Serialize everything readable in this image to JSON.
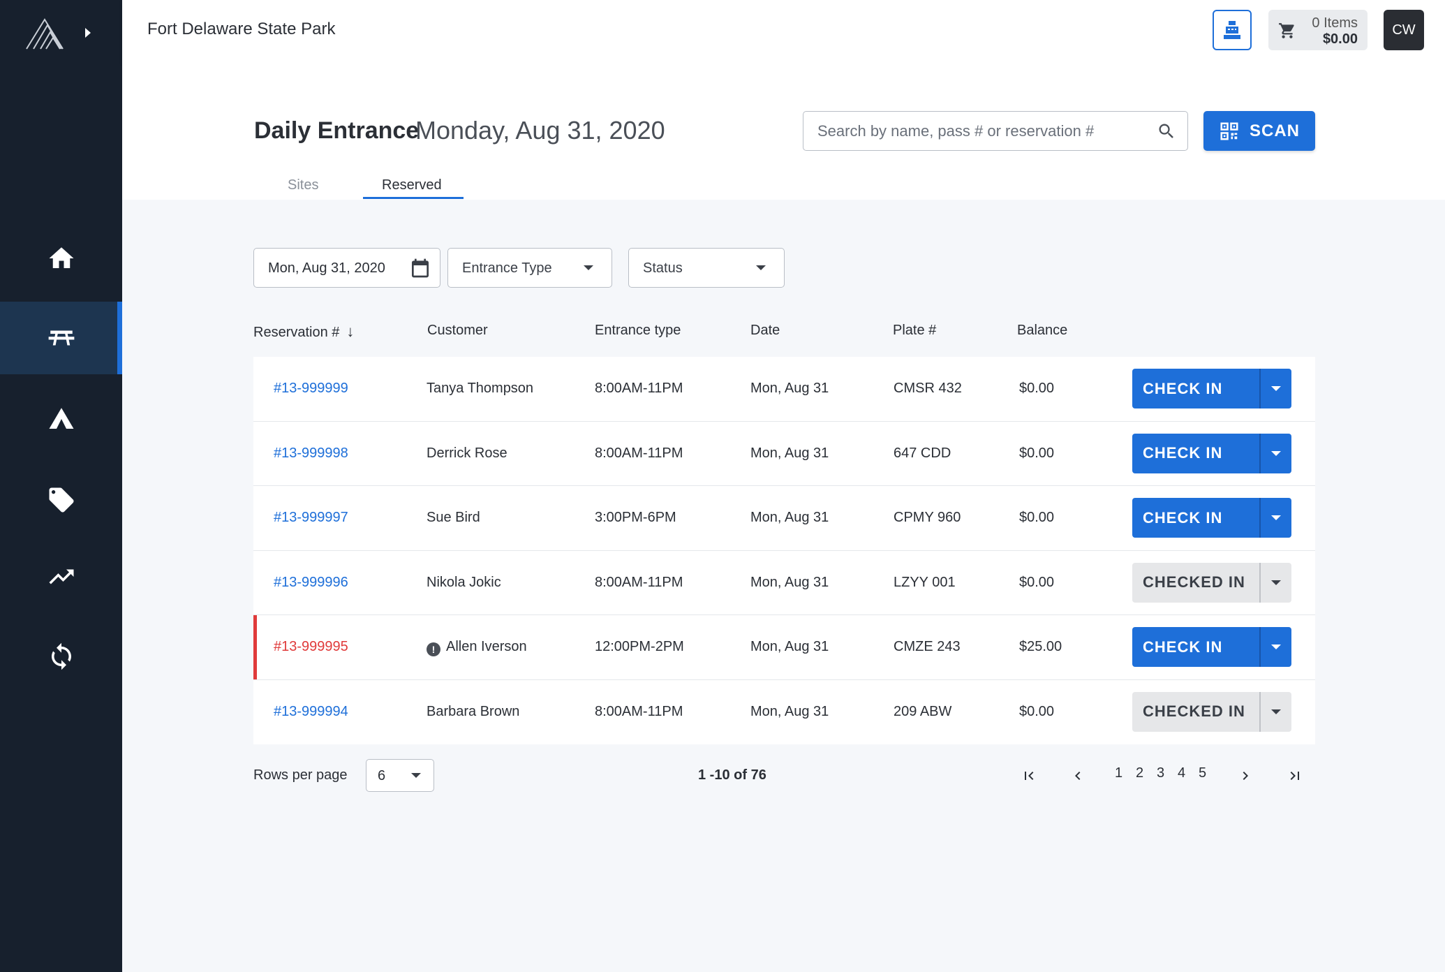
{
  "header": {
    "park_name": "Fort Delaware State Park",
    "cart_items": "0 Items",
    "cart_total": "$0.00",
    "avatar_initials": "CW"
  },
  "page": {
    "title": "Daily Entrance",
    "date": "Monday, Aug 31, 2020",
    "search_placeholder": "Search by name, pass # or reservation #",
    "scan_label": "SCAN",
    "tabs": [
      {
        "label": "Sites",
        "active": false
      },
      {
        "label": "Reserved",
        "active": true
      }
    ]
  },
  "filters": {
    "date_value": "Mon, Aug 31, 2020",
    "entrance_type": "Entrance Type",
    "status": "Status"
  },
  "table": {
    "columns": [
      "Reservation #",
      "Customer",
      "Entrance type",
      "Date",
      "Plate #",
      "Balance"
    ],
    "rows": [
      {
        "res": "#13-999999",
        "customer": "Tanya Thompson",
        "entrance": "8:00AM-11PM",
        "date": "Mon, Aug 31",
        "plate": "CMSR 432",
        "balance": "$0.00",
        "action": "CHECK IN"
      },
      {
        "res": "#13-999998",
        "customer": "Derrick Rose",
        "entrance": "8:00AM-11PM",
        "date": "Mon, Aug 31",
        "plate": "647 CDD",
        "balance": "$0.00",
        "action": "CHECK IN"
      },
      {
        "res": "#13-999997",
        "customer": "Sue Bird",
        "entrance": "3:00PM-6PM",
        "date": "Mon, Aug 31",
        "plate": "CPMY 960",
        "balance": "$0.00",
        "action": "CHECK IN"
      },
      {
        "res": "#13-999996",
        "customer": "Nikola Jokic",
        "entrance": "8:00AM-11PM",
        "date": "Mon, Aug 31",
        "plate": "LZYY 001",
        "balance": "$0.00",
        "action": "CHECKED IN"
      },
      {
        "res": "#13-999995",
        "customer": "Allen Iverson",
        "entrance": "12:00PM-2PM",
        "date": "Mon, Aug 31",
        "plate": "CMZE 243",
        "balance": "$25.00",
        "action": "CHECK IN"
      },
      {
        "res": "#13-999994",
        "customer": "Barbara Brown",
        "entrance": "8:00AM-11PM",
        "date": "Mon, Aug 31",
        "plate": "209 ABW",
        "balance": "$0.00",
        "action": "CHECKED IN"
      }
    ]
  },
  "footer": {
    "rows_per_page_label": "Rows per page",
    "rows_per_page_value": "6",
    "range": "1 -10 of 76",
    "pages": [
      "1",
      "2",
      "3",
      "4",
      "5"
    ]
  },
  "colors": {
    "primary": "#1e6fd9",
    "sidebar": "#17202d",
    "alert": "#e03a3a"
  }
}
